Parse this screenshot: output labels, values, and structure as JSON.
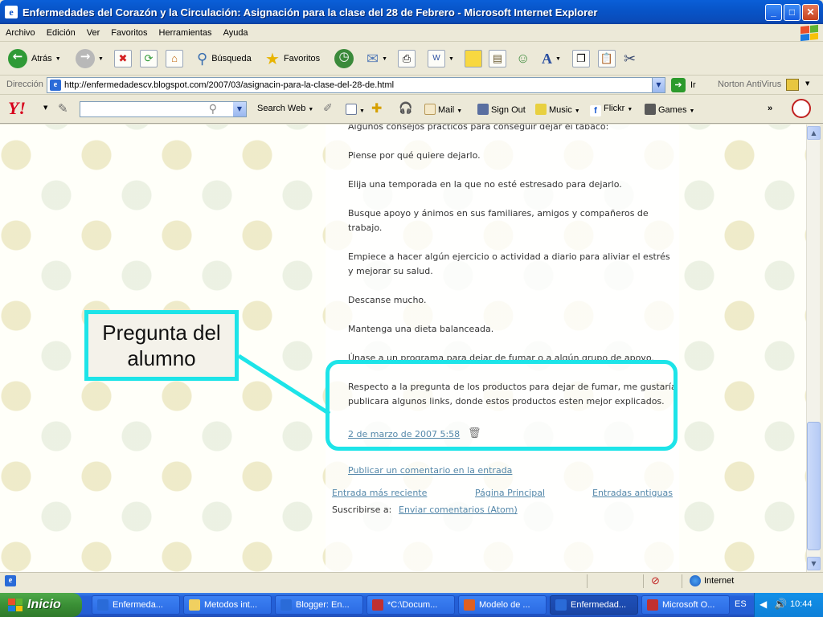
{
  "window": {
    "title": "Enfermedades del Corazón y la Circulación: Asignación para la clase del 28 de Febrero - Microsoft Internet Explorer"
  },
  "menu": [
    "Archivo",
    "Edición",
    "Ver",
    "Favoritos",
    "Herramientas",
    "Ayuda"
  ],
  "toolbar": {
    "back": "Atrás",
    "search": "Búsqueda",
    "favorites": "Favoritos"
  },
  "address": {
    "label": "Dirección",
    "url": "http://enfermedadescv.blogspot.com/2007/03/asignacin-para-la-clase-del-28-de.html",
    "go": "Ir",
    "norton": "Norton AntiVirus"
  },
  "yahoo": {
    "logo": "Y!",
    "search_web": "Search Web",
    "mail": "Mail",
    "sign_out": "Sign Out",
    "music": "Music",
    "flickr": "Flickr",
    "games": "Games",
    "more": "»"
  },
  "post": {
    "paragraphs": [
      "Algunos consejos prácticos para conseguir dejar el tabaco:",
      "Piense por qué quiere dejarlo.",
      "Elija una temporada en la que no esté estresado para dejarlo.",
      "Busque apoyo y ánimos en sus familiares, amigos y compañeros de trabajo.",
      "Empiece a hacer algún ejercicio o actividad a diario para aliviar el estrés y mejorar su salud.",
      "Descanse mucho.",
      "Mantenga una dieta balanceada."
    ],
    "partial_line": "Únase a un programa para dejar de fumar o a algún grupo de apoyo."
  },
  "comment": {
    "text": "Respecto a la pregunta de los productos para dejar de fumar, me gustaría publicara algunos links, donde estos productos esten mejor explicados.",
    "timestamp": "2 de marzo de 2007 5:58"
  },
  "links": {
    "publish_comment": "Publicar un comentario en la entrada",
    "newer": "Entrada más reciente",
    "home": "Página Principal",
    "older": "Entradas antiguas",
    "subscribe_label": "Suscribirse a:",
    "subscribe_link": "Enviar comentarios (Atom)"
  },
  "callout": {
    "line1": "Pregunta del",
    "line2": "alumno"
  },
  "status": {
    "zone": "Internet"
  },
  "taskbar": {
    "start": "Inicio",
    "tasks": [
      "Enfermeda...",
      "Metodos int...",
      "Blogger: En...",
      "*C:\\Docum...",
      "Modelo de ...",
      "Enfermedad...",
      "Microsoft O..."
    ],
    "lang": "ES",
    "clock": "10:44"
  },
  "colors": {
    "highlight": "#1de4e8",
    "link": "#5588aa",
    "title_bar": "#0a52c9"
  }
}
